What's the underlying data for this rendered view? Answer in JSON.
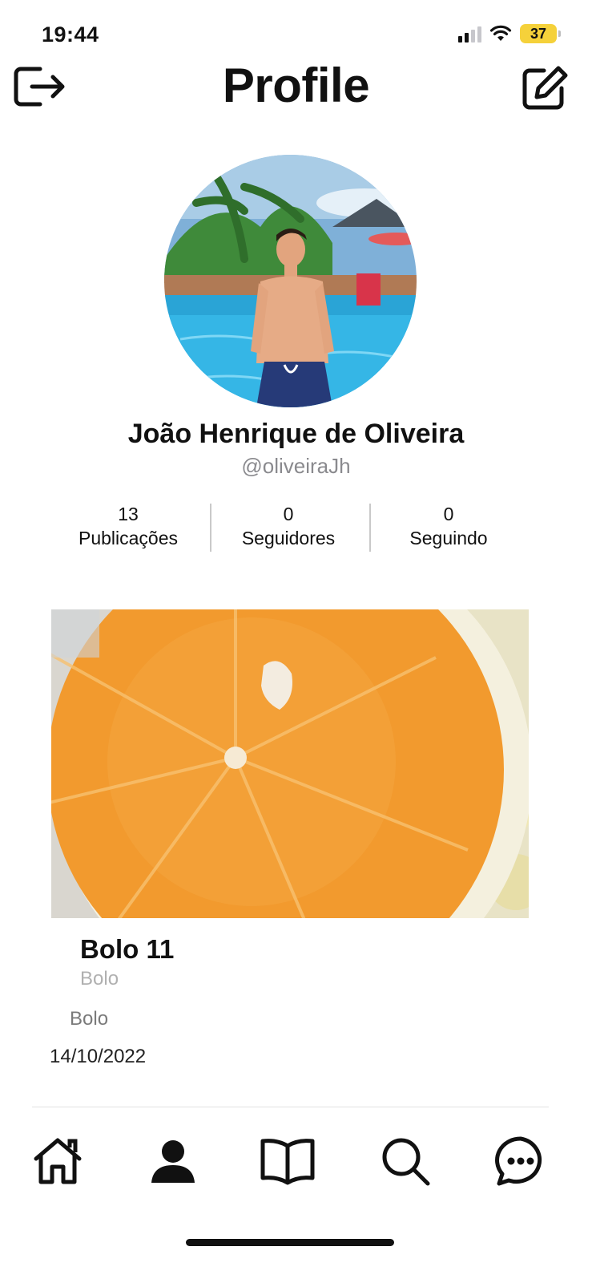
{
  "status_bar": {
    "time": "19:44",
    "battery": "37"
  },
  "header": {
    "title": "Profile",
    "logout_icon": "logout-icon",
    "edit_icon": "edit-icon"
  },
  "profile": {
    "name": "João Henrique de Oliveira",
    "handle": "@oliveiraJh",
    "stats": [
      {
        "value": "13",
        "label": "Publicações"
      },
      {
        "value": "0",
        "label": "Seguidores"
      },
      {
        "value": "0",
        "label": "Seguindo"
      }
    ]
  },
  "post": {
    "title": "Bolo 11",
    "category": "Bolo",
    "description": "Bolo",
    "date": "14/10/2022"
  },
  "tabs": [
    {
      "name": "home",
      "icon": "home-icon"
    },
    {
      "name": "profile",
      "icon": "user-icon",
      "active": true
    },
    {
      "name": "book",
      "icon": "book-icon"
    },
    {
      "name": "search",
      "icon": "search-icon"
    },
    {
      "name": "chat",
      "icon": "chat-icon"
    }
  ],
  "colors": {
    "accent": "#111111",
    "battery": "#f5d13a",
    "secondary_text": "#8a8a8e"
  }
}
